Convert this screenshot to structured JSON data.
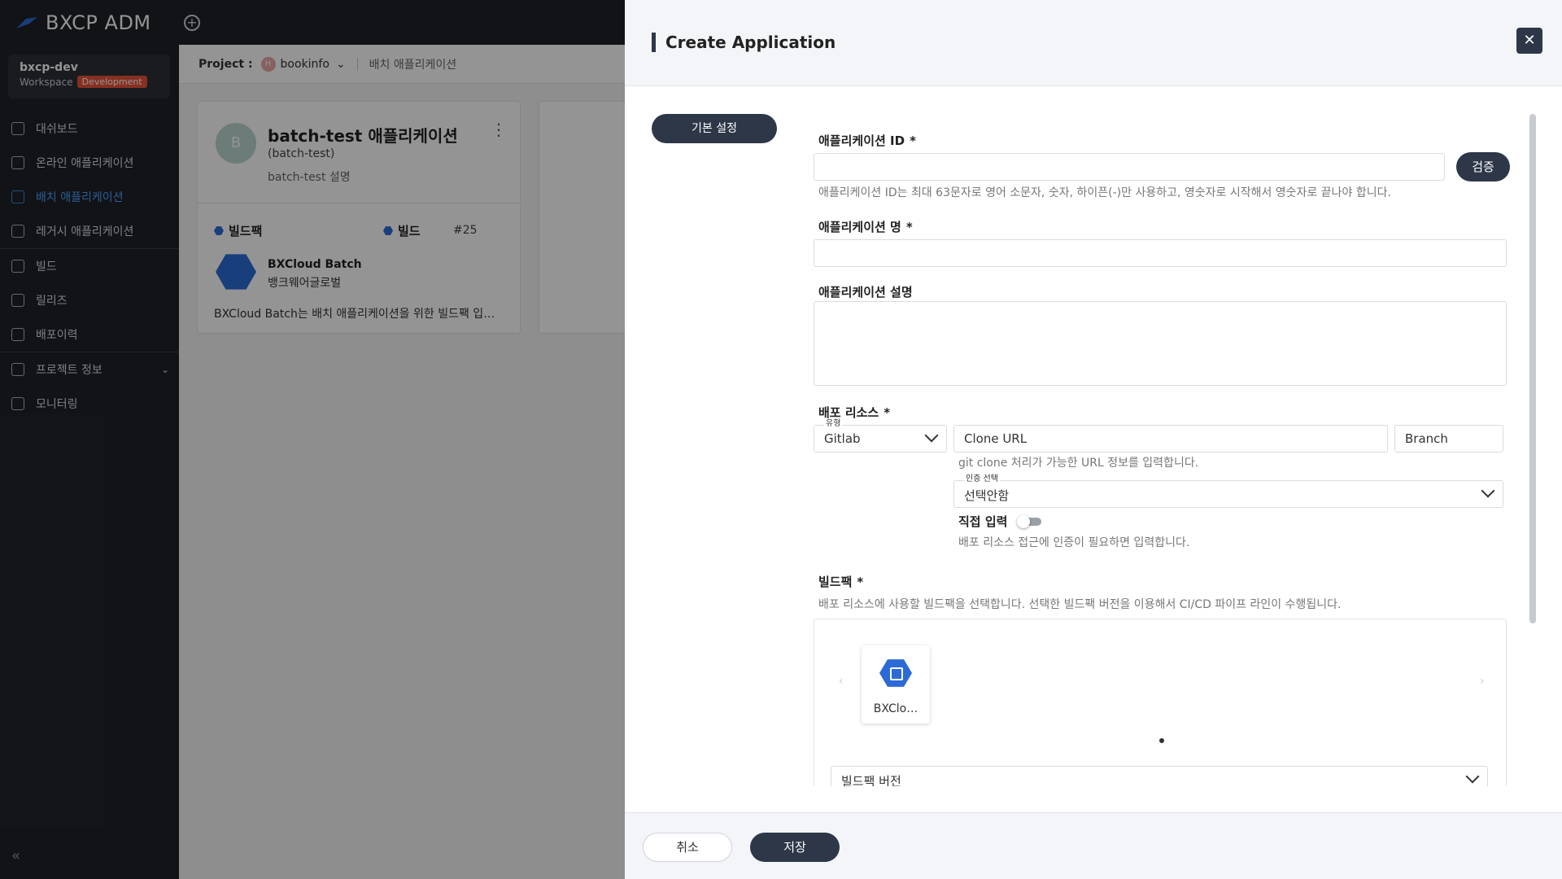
{
  "app": {
    "logo": "BXCP ADM"
  },
  "workspace": {
    "name": "bxcp-dev",
    "label": "Workspace",
    "badge": "Development"
  },
  "sidebar": {
    "items": [
      {
        "label": "대쉬보드",
        "icon": "dashboard-icon"
      },
      {
        "label": "온라인 애플리케이션",
        "icon": "online-app-icon"
      },
      {
        "label": "배치 애플리케이션",
        "icon": "batch-app-icon"
      },
      {
        "label": "레거시 애플리케이션",
        "icon": "legacy-app-icon"
      },
      {
        "label": "빌드",
        "icon": "build-icon"
      },
      {
        "label": "릴리즈",
        "icon": "release-icon"
      },
      {
        "label": "배포이력",
        "icon": "deploy-history-icon"
      },
      {
        "label": "프로젝트 정보",
        "icon": "project-info-icon"
      },
      {
        "label": "모니터링",
        "icon": "monitoring-icon"
      }
    ]
  },
  "breadcrumb": {
    "label": "Project :",
    "project_initial": "H",
    "project": "bookinfo",
    "page": "배치 애플리케이션"
  },
  "card": {
    "avatar": "B",
    "title": "batch-test 애플리케이션",
    "id": "(batch-test)",
    "description": "batch-test 설명",
    "buildpack_label": "빌드팩",
    "build_label": "빌드",
    "build_number": "#25",
    "buildpack_name": "BXCloud Batch",
    "buildpack_vendor": "뱅크웨어글로벌",
    "buildpack_desc": "BXCloud Batch는 배치 애플리케이션을 위한 빌드팩 입…"
  },
  "drawer": {
    "title": "Create Application",
    "tab": "기본 설정",
    "app_id": {
      "label": "애플리케이션 ID",
      "required": "*",
      "value": "",
      "verify": "검증",
      "hint": "애플리케이션 ID는 최대 63문자로 영어 소문자, 숫자, 하이픈(-)만 사용하고, 영숫자로 시작해서 영숫자로 끝나야 합니다."
    },
    "app_name": {
      "label": "애플리케이션 명",
      "required": "*",
      "value": ""
    },
    "app_desc": {
      "label": "애플리케이션 설명",
      "value": ""
    },
    "deploy_resource": {
      "label": "배포 리소스",
      "required": "*",
      "type_label": "유형",
      "type_value": "Gitlab",
      "clone_url_placeholder": "Clone URL",
      "branch_placeholder": "Branch",
      "clone_hint": "git clone 처리가 가능한 URL 정보를 입력합니다.",
      "auth_label": "인증 선택",
      "auth_value": "선택안함",
      "direct_input": "직접 입력",
      "auth_hint": "배포 리소스 접근에 인증이 필요하면 입력합니다."
    },
    "buildpack": {
      "label": "빌드팩",
      "required": "*",
      "hint": "배포 리소스에 사용할 빌드팩을 선택합니다. 선택한 빌드팩 버전을 이용해서 CI/CD 파이프 라인이 수행됩니다.",
      "tile_name": "BXClo…",
      "version_label": "빌드팩 버전"
    },
    "cancel": "취소",
    "save": "저장"
  }
}
